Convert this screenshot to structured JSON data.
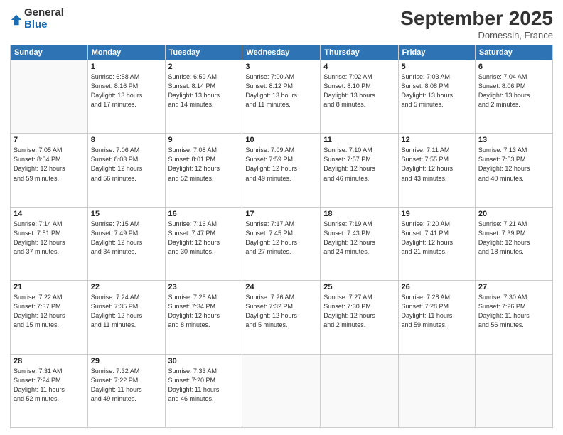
{
  "logo": {
    "general": "General",
    "blue": "Blue"
  },
  "header": {
    "title": "September 2025",
    "location": "Domessin, France"
  },
  "weekdays": [
    "Sunday",
    "Monday",
    "Tuesday",
    "Wednesday",
    "Thursday",
    "Friday",
    "Saturday"
  ],
  "weeks": [
    [
      {
        "day": "",
        "info": ""
      },
      {
        "day": "1",
        "info": "Sunrise: 6:58 AM\nSunset: 8:16 PM\nDaylight: 13 hours\nand 17 minutes."
      },
      {
        "day": "2",
        "info": "Sunrise: 6:59 AM\nSunset: 8:14 PM\nDaylight: 13 hours\nand 14 minutes."
      },
      {
        "day": "3",
        "info": "Sunrise: 7:00 AM\nSunset: 8:12 PM\nDaylight: 13 hours\nand 11 minutes."
      },
      {
        "day": "4",
        "info": "Sunrise: 7:02 AM\nSunset: 8:10 PM\nDaylight: 13 hours\nand 8 minutes."
      },
      {
        "day": "5",
        "info": "Sunrise: 7:03 AM\nSunset: 8:08 PM\nDaylight: 13 hours\nand 5 minutes."
      },
      {
        "day": "6",
        "info": "Sunrise: 7:04 AM\nSunset: 8:06 PM\nDaylight: 13 hours\nand 2 minutes."
      }
    ],
    [
      {
        "day": "7",
        "info": "Sunrise: 7:05 AM\nSunset: 8:04 PM\nDaylight: 12 hours\nand 59 minutes."
      },
      {
        "day": "8",
        "info": "Sunrise: 7:06 AM\nSunset: 8:03 PM\nDaylight: 12 hours\nand 56 minutes."
      },
      {
        "day": "9",
        "info": "Sunrise: 7:08 AM\nSunset: 8:01 PM\nDaylight: 12 hours\nand 52 minutes."
      },
      {
        "day": "10",
        "info": "Sunrise: 7:09 AM\nSunset: 7:59 PM\nDaylight: 12 hours\nand 49 minutes."
      },
      {
        "day": "11",
        "info": "Sunrise: 7:10 AM\nSunset: 7:57 PM\nDaylight: 12 hours\nand 46 minutes."
      },
      {
        "day": "12",
        "info": "Sunrise: 7:11 AM\nSunset: 7:55 PM\nDaylight: 12 hours\nand 43 minutes."
      },
      {
        "day": "13",
        "info": "Sunrise: 7:13 AM\nSunset: 7:53 PM\nDaylight: 12 hours\nand 40 minutes."
      }
    ],
    [
      {
        "day": "14",
        "info": "Sunrise: 7:14 AM\nSunset: 7:51 PM\nDaylight: 12 hours\nand 37 minutes."
      },
      {
        "day": "15",
        "info": "Sunrise: 7:15 AM\nSunset: 7:49 PM\nDaylight: 12 hours\nand 34 minutes."
      },
      {
        "day": "16",
        "info": "Sunrise: 7:16 AM\nSunset: 7:47 PM\nDaylight: 12 hours\nand 30 minutes."
      },
      {
        "day": "17",
        "info": "Sunrise: 7:17 AM\nSunset: 7:45 PM\nDaylight: 12 hours\nand 27 minutes."
      },
      {
        "day": "18",
        "info": "Sunrise: 7:19 AM\nSunset: 7:43 PM\nDaylight: 12 hours\nand 24 minutes."
      },
      {
        "day": "19",
        "info": "Sunrise: 7:20 AM\nSunset: 7:41 PM\nDaylight: 12 hours\nand 21 minutes."
      },
      {
        "day": "20",
        "info": "Sunrise: 7:21 AM\nSunset: 7:39 PM\nDaylight: 12 hours\nand 18 minutes."
      }
    ],
    [
      {
        "day": "21",
        "info": "Sunrise: 7:22 AM\nSunset: 7:37 PM\nDaylight: 12 hours\nand 15 minutes."
      },
      {
        "day": "22",
        "info": "Sunrise: 7:24 AM\nSunset: 7:35 PM\nDaylight: 12 hours\nand 11 minutes."
      },
      {
        "day": "23",
        "info": "Sunrise: 7:25 AM\nSunset: 7:34 PM\nDaylight: 12 hours\nand 8 minutes."
      },
      {
        "day": "24",
        "info": "Sunrise: 7:26 AM\nSunset: 7:32 PM\nDaylight: 12 hours\nand 5 minutes."
      },
      {
        "day": "25",
        "info": "Sunrise: 7:27 AM\nSunset: 7:30 PM\nDaylight: 12 hours\nand 2 minutes."
      },
      {
        "day": "26",
        "info": "Sunrise: 7:28 AM\nSunset: 7:28 PM\nDaylight: 11 hours\nand 59 minutes."
      },
      {
        "day": "27",
        "info": "Sunrise: 7:30 AM\nSunset: 7:26 PM\nDaylight: 11 hours\nand 56 minutes."
      }
    ],
    [
      {
        "day": "28",
        "info": "Sunrise: 7:31 AM\nSunset: 7:24 PM\nDaylight: 11 hours\nand 52 minutes."
      },
      {
        "day": "29",
        "info": "Sunrise: 7:32 AM\nSunset: 7:22 PM\nDaylight: 11 hours\nand 49 minutes."
      },
      {
        "day": "30",
        "info": "Sunrise: 7:33 AM\nSunset: 7:20 PM\nDaylight: 11 hours\nand 46 minutes."
      },
      {
        "day": "",
        "info": ""
      },
      {
        "day": "",
        "info": ""
      },
      {
        "day": "",
        "info": ""
      },
      {
        "day": "",
        "info": ""
      }
    ]
  ]
}
